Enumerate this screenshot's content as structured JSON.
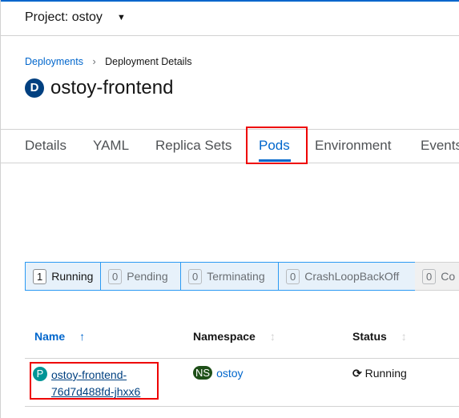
{
  "project": {
    "label": "Project: ostoy"
  },
  "breadcrumb": {
    "parent": "Deployments",
    "current": "Deployment Details"
  },
  "title": {
    "badge": "D",
    "name": "ostoy-frontend"
  },
  "tabs": [
    "Details",
    "YAML",
    "Replica Sets",
    "Pods",
    "Environment",
    "Events"
  ],
  "active_tab": "Pods",
  "filters": [
    {
      "count": "1",
      "label": "Running"
    },
    {
      "count": "0",
      "label": "Pending"
    },
    {
      "count": "0",
      "label": "Terminating"
    },
    {
      "count": "0",
      "label": "CrashLoopBackOff"
    },
    {
      "count": "0",
      "label": "Co"
    }
  ],
  "table": {
    "headers": {
      "name": "Name",
      "namespace": "Namespace",
      "status": "Status"
    },
    "rows": [
      {
        "badge": "P",
        "name_line1": "ostoy-frontend-",
        "name_line2": "76d7d488fd-jhxx6",
        "ns_badge": "NS",
        "namespace": "ostoy",
        "status": "Running"
      }
    ]
  },
  "colors": {
    "accent": "#0066cc",
    "highlight": "#ee0000"
  }
}
